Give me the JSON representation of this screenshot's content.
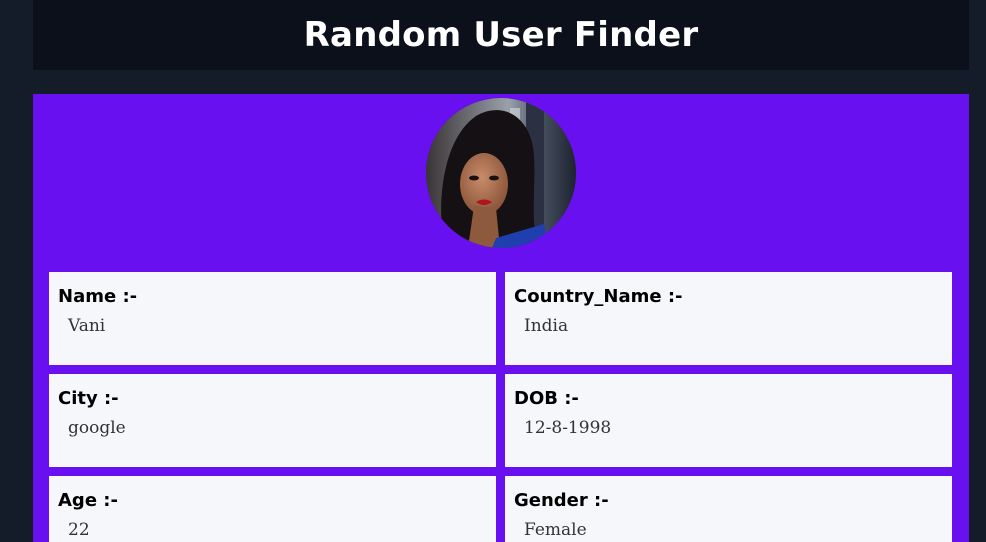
{
  "app": {
    "title": "Random User Finder"
  },
  "user": {
    "avatar_icon": "user-avatar-photo",
    "fields": [
      {
        "label": "Name :-",
        "value": "Vani"
      },
      {
        "label": "Country_Name :-",
        "value": "India"
      },
      {
        "label": "City :-",
        "value": "google"
      },
      {
        "label": "DOB :-",
        "value": "12-8-1998"
      },
      {
        "label": "Age :-",
        "value": "22"
      },
      {
        "label": "Gender :-",
        "value": "Female"
      }
    ]
  },
  "colors": {
    "page_background": "#141b29",
    "header_background": "#0b101a",
    "card_background": "#6810f0",
    "field_background": "#f6f7fa"
  }
}
